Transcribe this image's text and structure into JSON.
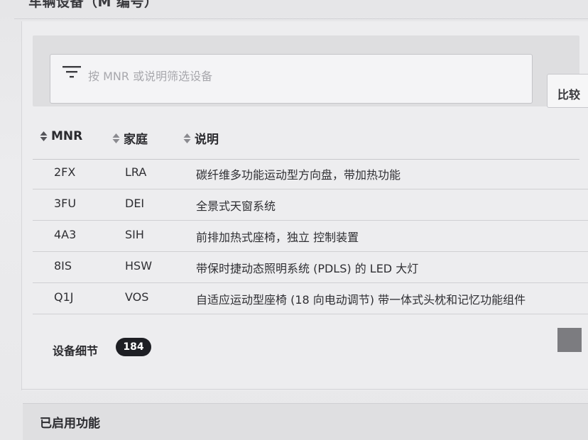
{
  "section_title": "车辆设备（M 编号）",
  "filter": {
    "placeholder": "按 MNR 或说明筛选设备",
    "compare_label": "比较"
  },
  "table": {
    "headers": {
      "mnr": "MNR",
      "family": "家庭",
      "description": "说明"
    },
    "rows": [
      {
        "mnr": "2FX",
        "family": "LRA",
        "description": "碳纤维多功能运动型方向盘，带加热功能"
      },
      {
        "mnr": "3FU",
        "family": "DEI",
        "description": "全景式天窗系统"
      },
      {
        "mnr": "4A3",
        "family": "SIH",
        "description": "前排加热式座椅，独立 控制装置"
      },
      {
        "mnr": "8IS",
        "family": "HSW",
        "description": "带保时捷动态照明系统 (PDLS) 的 LED 大灯"
      },
      {
        "mnr": "Q1J",
        "family": "VOS",
        "description": "自适应运动型座椅 (18 向电动调节) 带一体式头枕和记忆功能组件"
      }
    ]
  },
  "details": {
    "title": "设备细节",
    "count": "184"
  },
  "enabled_features": {
    "title": "已启用功能"
  },
  "colors": {
    "background": "#e9e9eb",
    "badge": "#1e1f24",
    "text": "#2a2a2e"
  }
}
